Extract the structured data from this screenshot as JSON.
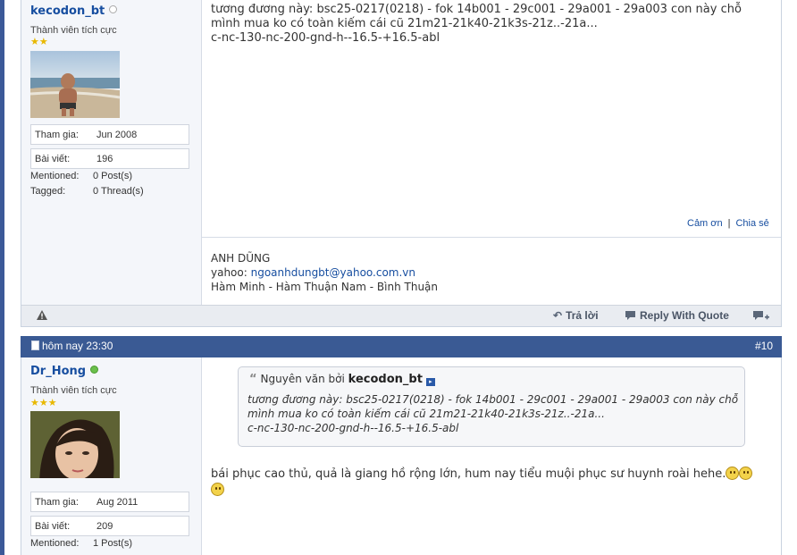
{
  "post1": {
    "user": {
      "name": "kecodon_bt",
      "title": "Thành viên tích cực",
      "stars": "★★",
      "status_color": "#bbbbbb",
      "stats": [
        {
          "label": "Tham gia:",
          "value": "Jun 2008"
        },
        {
          "label": "Bài viết:",
          "value": "196"
        }
      ],
      "mentioned_label": "Mentioned:",
      "mentioned_value": "0 Post(s)",
      "tagged_label": "Tagged:",
      "tagged_value": "0 Thread(s)"
    },
    "message_lines": [
      "tương đương này: bsc25-0217(0218) - fok 14b001 - 29c001 - 29a001 - 29a003 con này chỗ",
      "mình mua ko có toàn kiếm cái cũ 21m21-21k40-21k3s-21z..-21a...",
      "c-nc-130-nc-200-gnd-h--16.5-+16.5-abl"
    ],
    "thanks_label": "Cảm ơn",
    "separator": "|",
    "share_label": "Chia sẻ",
    "signature": {
      "line1": "ANH DŨNG",
      "line2_prefix": "yahoo: ",
      "line2_email": "ngoanhdungbt@yahoo.com.vn",
      "line3": "Hàm Minh - Hàm Thuận Nam - Bình Thuận"
    },
    "footer": {
      "report_icon": "warning-icon",
      "reply_label": "Trả lời",
      "reply_quote_label": "Reply With Quote",
      "multiquote_icon": "multiquote-plus-icon"
    }
  },
  "post2": {
    "date": "hôm nay 23:30",
    "number": "#10",
    "header_color": "#3a5a94",
    "user": {
      "name": "Dr_Hong",
      "title": "Thành viên tích cực",
      "stars": "★★★",
      "status_color": "#6abf4b",
      "stats": [
        {
          "label": "Tham gia:",
          "value": "Aug 2011"
        },
        {
          "label": "Bài viết:",
          "value": "209"
        }
      ],
      "mentioned_label": "Mentioned:",
      "mentioned_value": "1 Post(s)"
    },
    "quote": {
      "prefix": "Nguyên văn bởi",
      "author": "kecodon_bt",
      "lines": [
        "tương đương này: bsc25-0217(0218) - fok 14b001 - 29c001 - 29a001 - 29a003 con này chỗ",
        "mình mua ko có toàn kiếm cái cũ 21m21-21k40-21k3s-21z..-21a...",
        "c-nc-130-nc-200-gnd-h--16.5-+16.5-abl"
      ]
    },
    "message": "bái phục cao thủ, quả là giang hồ rộng lớn, hum nay tiểu muội phục sư huynh roài hehe."
  }
}
